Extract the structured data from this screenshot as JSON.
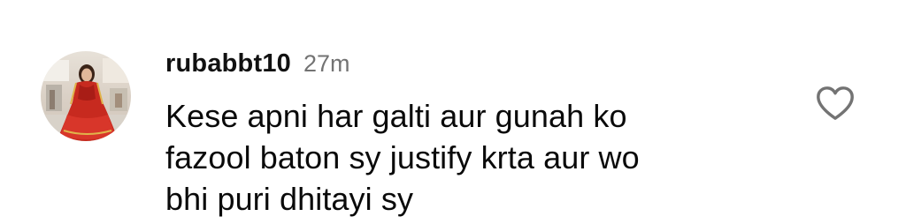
{
  "comment": {
    "username": "rubabbt10",
    "timestamp": "27m",
    "text_lines": [
      "Kese apni har galti aur gunah ko",
      "fazool baton sy justify krta aur wo",
      "bhi puri dhitayi sy"
    ],
    "avatar_icon": "profile-photo",
    "like_icon": "heart-outline-icon"
  }
}
